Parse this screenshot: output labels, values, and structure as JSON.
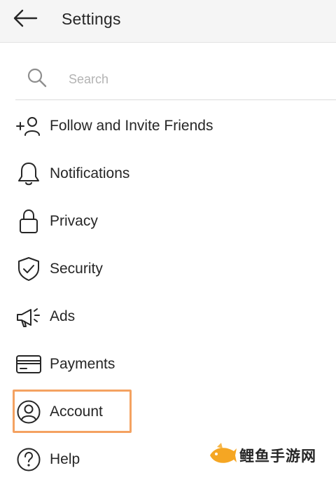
{
  "header": {
    "title": "Settings",
    "back_icon": "arrow-left-icon"
  },
  "search": {
    "placeholder": "Search",
    "value": "",
    "icon": "search-icon"
  },
  "menu": {
    "items": [
      {
        "label": "Follow and Invite Friends",
        "icon": "add-person-icon"
      },
      {
        "label": "Notifications",
        "icon": "bell-icon"
      },
      {
        "label": "Privacy",
        "icon": "lock-icon"
      },
      {
        "label": "Security",
        "icon": "shield-check-icon"
      },
      {
        "label": "Ads",
        "icon": "megaphone-icon"
      },
      {
        "label": "Payments",
        "icon": "credit-card-icon"
      },
      {
        "label": "Account",
        "icon": "account-circle-icon"
      },
      {
        "label": "Help",
        "icon": "help-circle-icon"
      }
    ]
  },
  "highlight": {
    "target": "Account",
    "color": "#f4a261"
  },
  "watermark": {
    "text": "鲤鱼手游网",
    "accent_color": "#f5a623"
  }
}
